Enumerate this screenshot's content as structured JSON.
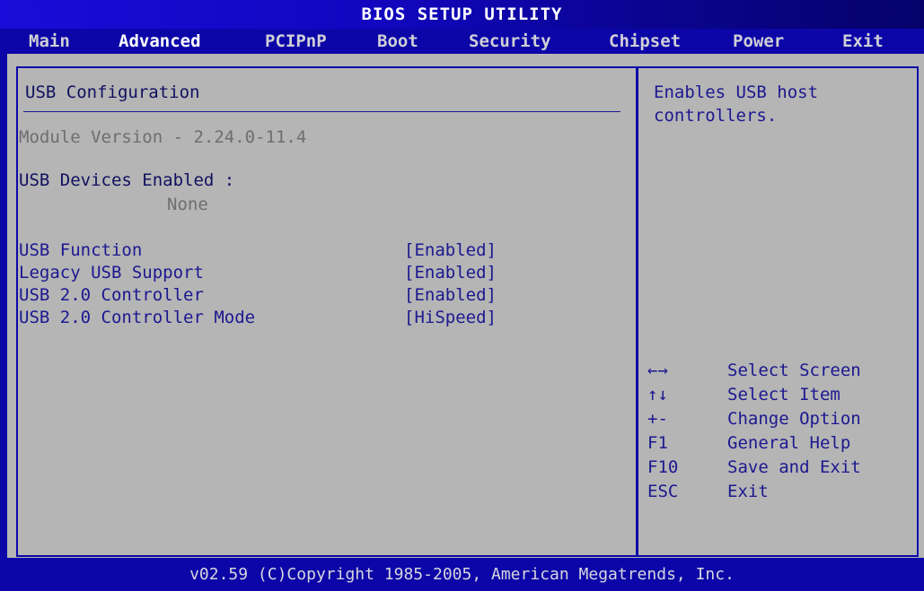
{
  "title": "BIOS SETUP UTILITY",
  "menu": {
    "items": [
      {
        "label": "Main"
      },
      {
        "label": "Advanced"
      },
      {
        "label": "PCIPnP"
      },
      {
        "label": "Boot"
      },
      {
        "label": "Security"
      },
      {
        "label": "Chipset"
      },
      {
        "label": "Power"
      },
      {
        "label": "Exit"
      }
    ],
    "active": "Advanced"
  },
  "main": {
    "section_title": "USB Configuration",
    "module_version": "Module Version - 2.24.0-11.4",
    "devices_label": "USB Devices Enabled :",
    "devices_value": "None",
    "settings": [
      {
        "label": "USB Function",
        "value": "[Enabled]"
      },
      {
        "label": "Legacy USB Support",
        "value": "[Enabled]"
      },
      {
        "label": "USB 2.0 Controller",
        "value": "[Enabled]"
      },
      {
        "label": "USB 2.0 Controller Mode",
        "value": "[HiSpeed]"
      }
    ]
  },
  "help": {
    "description": "Enables USB host\ncontrollers.",
    "keys": [
      {
        "key": "←→",
        "action": "Select Screen"
      },
      {
        "key": "↑↓",
        "action": "Select Item"
      },
      {
        "key": "+-",
        "action": "Change Option"
      },
      {
        "key": "F1",
        "action": "General Help"
      },
      {
        "key": "F10",
        "action": "Save and Exit"
      },
      {
        "key": "ESC",
        "action": "Exit"
      }
    ]
  },
  "footer": "v02.59 (C)Copyright 1985-2005, American Megatrends, Inc.",
  "colors": {
    "background_blue": "#0c06a8",
    "panel_grey": "#b5b5b5",
    "text_blue": "#1c1890",
    "text_grey": "#6e6e72"
  }
}
